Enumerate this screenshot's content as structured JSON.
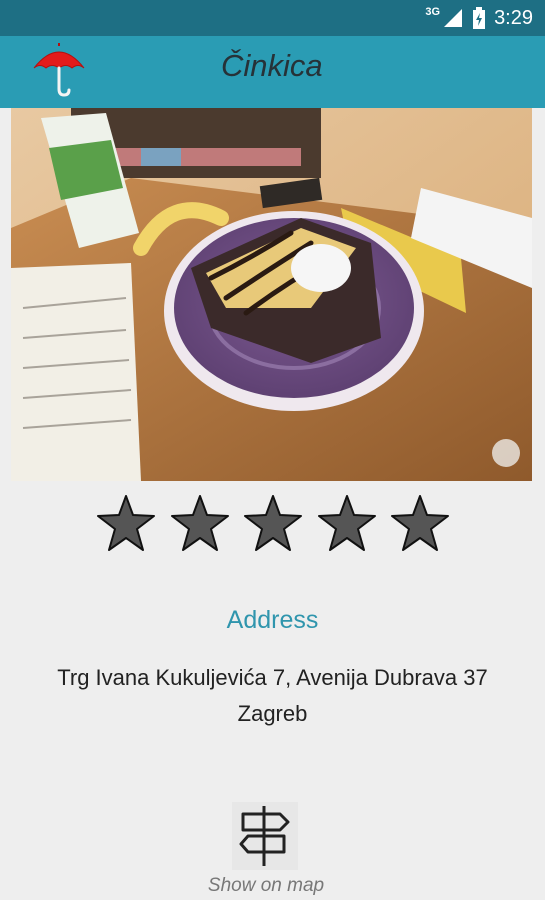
{
  "status_bar": {
    "network": "3G",
    "time": "3:29",
    "icons": [
      "signal-icon",
      "battery-icon"
    ]
  },
  "app_bar": {
    "title": "Činkica",
    "logo_icon": "umbrella-icon",
    "background": "#2a9cb4",
    "status_bar_background": "#1e6f84"
  },
  "photo": {
    "subject": "crepe-with-chocolate-and-banana-on-purple-plate"
  },
  "rating": {
    "value": 5,
    "max": 5,
    "star_color": "#555555"
  },
  "address": {
    "label": "Address",
    "line1": "Trg Ivana Kukuljevića 7, Avenija Dubrava 37",
    "line2": "Zagreb",
    "label_color": "#2f95ad"
  },
  "map": {
    "icon": "signpost-icon",
    "label": "Show on map"
  }
}
